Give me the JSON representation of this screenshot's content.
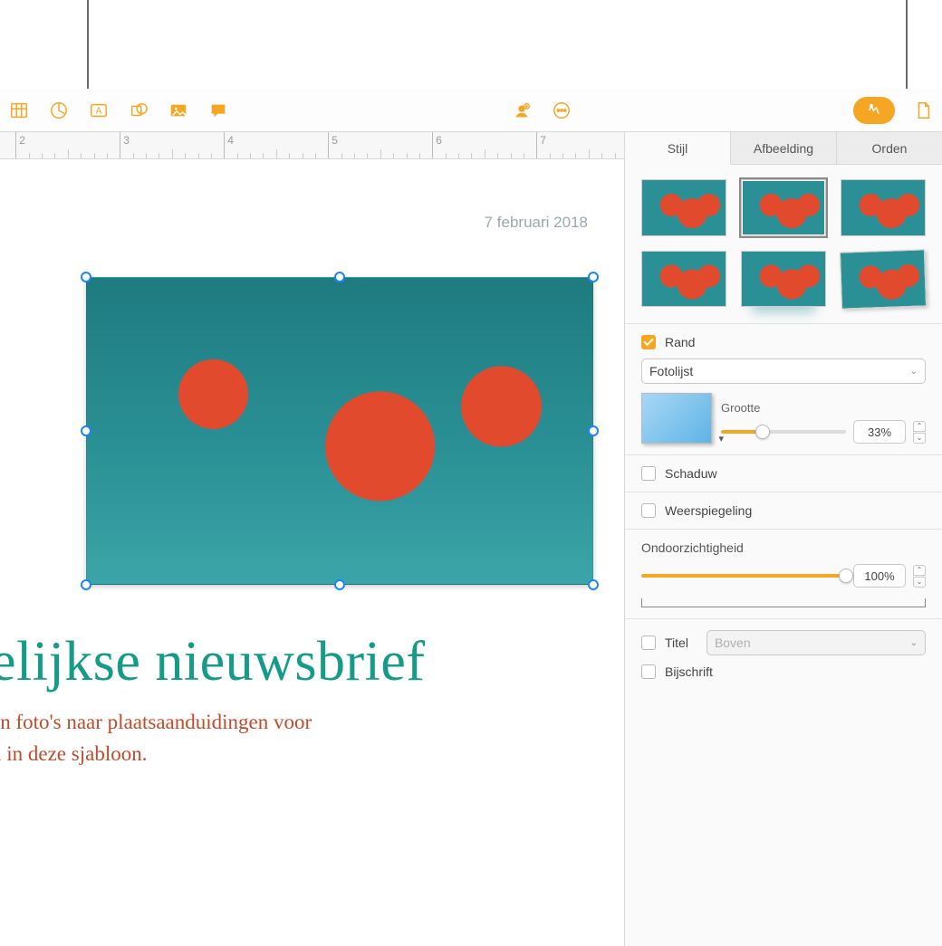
{
  "toolbar": {
    "icons": [
      "table",
      "chart",
      "text",
      "shape",
      "media",
      "comment",
      "collab",
      "more",
      "format",
      "document"
    ]
  },
  "ruler": {
    "start": 2,
    "end": 7
  },
  "canvas": {
    "date": "7 februari 2018",
    "headline": "elijkse nieuwsbrief",
    "subtext_line1": "en foto's naar plaatsaanduidingen voor",
    "subtext_line2": "n in deze sjabloon."
  },
  "inspector": {
    "tabs": {
      "style": "Stijl",
      "image": "Afbeelding",
      "arrange": "Orden"
    },
    "border": {
      "label": "Rand",
      "checked": true,
      "type_value": "Fotolijst",
      "size_label": "Grootte",
      "size_value": "33%",
      "size_pct": 33
    },
    "shadow": {
      "label": "Schaduw",
      "checked": false
    },
    "reflection": {
      "label": "Weerspiegeling",
      "checked": false
    },
    "opacity": {
      "label": "Ondoorzichtigheid",
      "value": "100%",
      "pct": 100
    },
    "title": {
      "label": "Titel",
      "checked": false,
      "position": "Boven"
    },
    "caption": {
      "label": "Bijschrift",
      "checked": false
    }
  }
}
